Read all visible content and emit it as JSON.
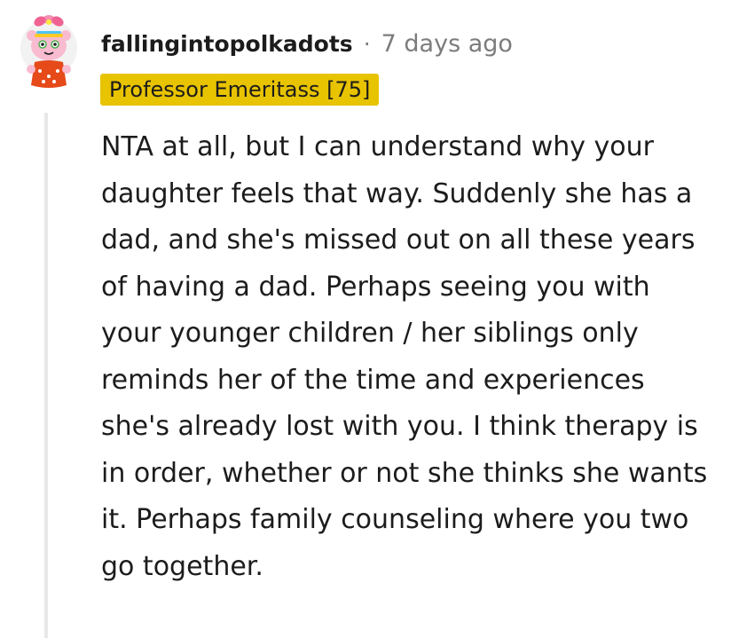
{
  "comment": {
    "author": "fallingintopolkadots",
    "separator": "·",
    "timestamp": "7 days ago",
    "flair": "Professor Emeritass [75]",
    "avatar_icon": "snoo-avatar-icon",
    "body": "NTA at all, but I can understand why your daughter feels that way. Suddenly she has a dad, and she's missed out on all these years of having a dad. Perhaps seeing you with your younger children / her siblings only reminds her of the time and experiences she's already lost with you. I think therapy is in order, whether or not she thinks she wants it. Perhaps family counseling where you two go together."
  },
  "colors": {
    "flair_background": "#e8c300",
    "text": "#1c1c1c",
    "meta_text": "#7c7c7c",
    "thread_line": "#e8e8e8"
  }
}
